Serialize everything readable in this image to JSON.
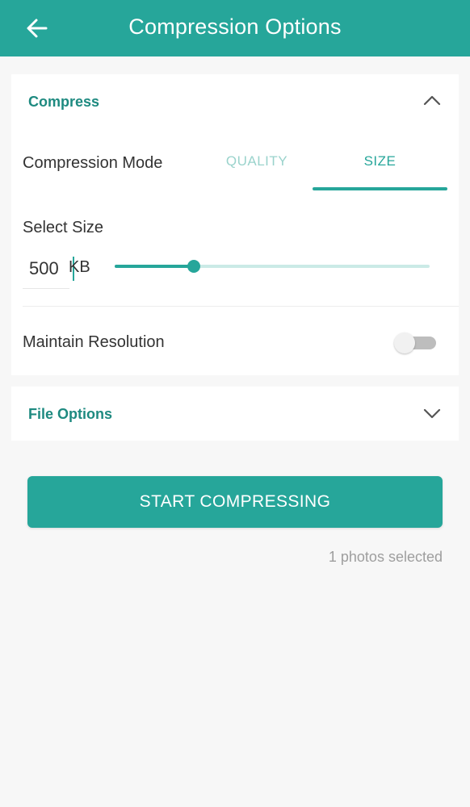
{
  "appbar": {
    "title": "Compression Options",
    "back_icon": "arrow-left-icon",
    "color": "#26a69a"
  },
  "compress_section": {
    "title": "Compress",
    "expanded": true,
    "chevron_icon": "chevron-up-icon",
    "mode_label": "Compression Mode",
    "tabs": [
      {
        "label": "QUALITY",
        "selected": false
      },
      {
        "label": "SIZE",
        "selected": true
      }
    ],
    "select_size_label": "Select Size",
    "size_value": "500",
    "size_unit": "KB",
    "slider_level": 0.25,
    "maintain_resolution_label": "Maintain Resolution",
    "maintain_resolution_on": false
  },
  "file_options_section": {
    "title": "File Options",
    "expanded": false,
    "chevron_icon": "chevron-down-icon"
  },
  "start_button_label": "START COMPRESSING",
  "status_text": "1 photos selected",
  "colors": {
    "accent": "#26a69a",
    "accent_light": "#cbeae6",
    "background": "#f7f7f7"
  }
}
